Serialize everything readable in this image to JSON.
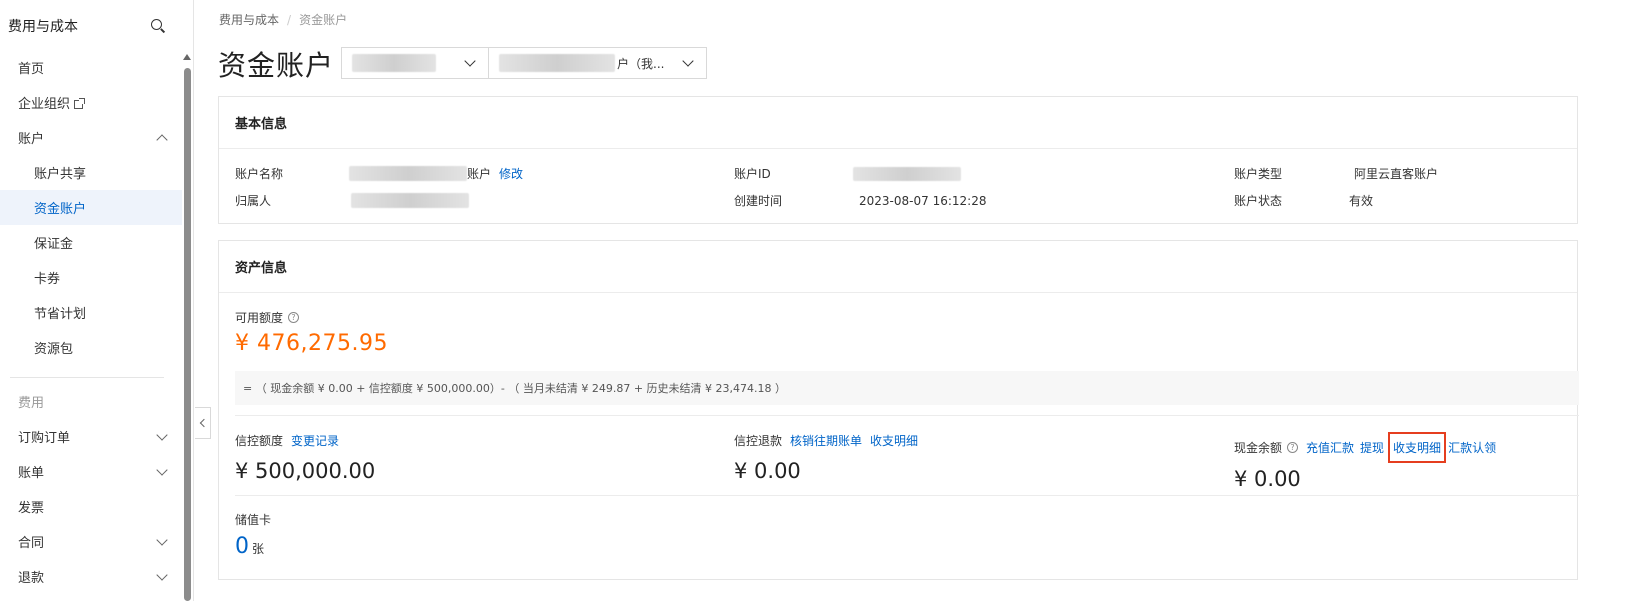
{
  "sidebar": {
    "title": "费用与成本",
    "items": [
      {
        "label": "首页"
      },
      {
        "label": "企业组织"
      },
      {
        "label": "账户"
      },
      {
        "label": "账户共享"
      },
      {
        "label": "资金账户"
      },
      {
        "label": "保证金"
      },
      {
        "label": "卡券"
      },
      {
        "label": "节省计划"
      },
      {
        "label": "资源包"
      },
      {
        "label": "费用"
      },
      {
        "label": "订购订单"
      },
      {
        "label": "账单"
      },
      {
        "label": "发票"
      },
      {
        "label": "合同"
      },
      {
        "label": "退款"
      }
    ]
  },
  "breadcrumb": {
    "root": "费用与成本",
    "separator": "/",
    "current": "资金账户"
  },
  "page": {
    "title": "资金账户"
  },
  "selectors": {
    "second_suffix": "户（我..."
  },
  "basic_info": {
    "title": "基本信息",
    "account_name_label": "账户名称",
    "account_name_suffix": "账户",
    "modify_link": "修改",
    "owner_label": "归属人",
    "account_id_label": "账户ID",
    "created_label": "创建时间",
    "created_value": "2023-08-07 16:12:28",
    "account_type_label": "账户类型",
    "account_type_value": "阿里云直客账户",
    "account_status_label": "账户状态",
    "account_status_value": "有效"
  },
  "asset_info": {
    "title": "资产信息",
    "available_label": "可用额度",
    "available_amount": "¥ 476,275.95",
    "formula": "= （ 现金余额 ¥ 0.00 + 信控额度 ¥ 500,000.00）- （ 当月未结清 ¥ 249.87 + 历史未结清 ¥ 23,474.18 ）",
    "credit": {
      "label": "信控额度",
      "link": "变更记录",
      "amount": "¥ 500,000.00"
    },
    "credit_refund": {
      "label": "信控退款",
      "link1": "核销往期账单",
      "link2": "收支明细",
      "amount": "¥ 0.00"
    },
    "cash": {
      "label": "现金余额",
      "link1": "充值汇款",
      "link2": "提现",
      "link3": "收支明细",
      "link4": "汇款认领",
      "amount": "¥ 0.00"
    },
    "stored_card": {
      "label": "储值卡",
      "count": "0",
      "unit": "张"
    }
  },
  "colors": {
    "accent": "#0064c8",
    "amount_orange": "#ff6a00",
    "highlight_red": "#e53e1f"
  }
}
